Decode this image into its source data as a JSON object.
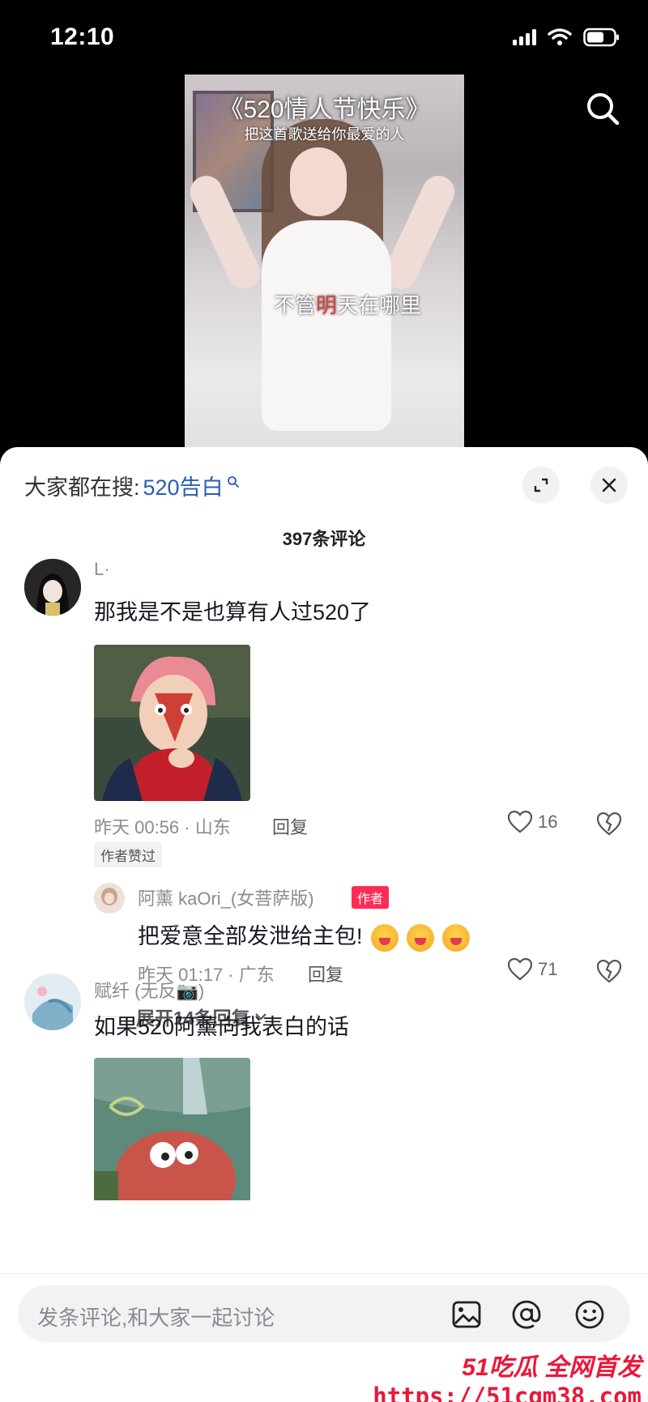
{
  "status": {
    "time": "12:10"
  },
  "video": {
    "title": "《520情人节快乐》",
    "subtitle": "把这首歌送给你最爱的人",
    "lyric_pre": "不管",
    "lyric_hl": "明",
    "lyric_post": "天在哪里"
  },
  "panel": {
    "trending_label": "大家都在搜:",
    "trending_keyword": "520告白",
    "comment_count": "397条评论"
  },
  "comments": [
    {
      "name": "L·",
      "text": "那我是不是也算有人过520了",
      "time": "昨天 00:56 · 山东",
      "reply_label": "回复",
      "likes": "16",
      "badge": "作者赞过",
      "reply": {
        "name": "阿薰 kaOri_(女菩萨版)",
        "tag": "作者",
        "text": "把爱意全部发泄给主包!",
        "time": "昨天 01:17 · 广东",
        "reply_label": "回复",
        "likes": "71"
      },
      "expand": "展开14条回复"
    },
    {
      "name": "赋纤 (无反📷)",
      "text": "如果520阿薰向我表白的话"
    }
  ],
  "input": {
    "placeholder": "发条评论,和大家一起讨论"
  },
  "watermark": {
    "top": "51吃瓜 全网首发",
    "url": "https://51cgm38.com"
  },
  "colors": {
    "accent": "#fe2c55",
    "keyword": "#2b5bb5",
    "muted": "#8a8b91"
  }
}
